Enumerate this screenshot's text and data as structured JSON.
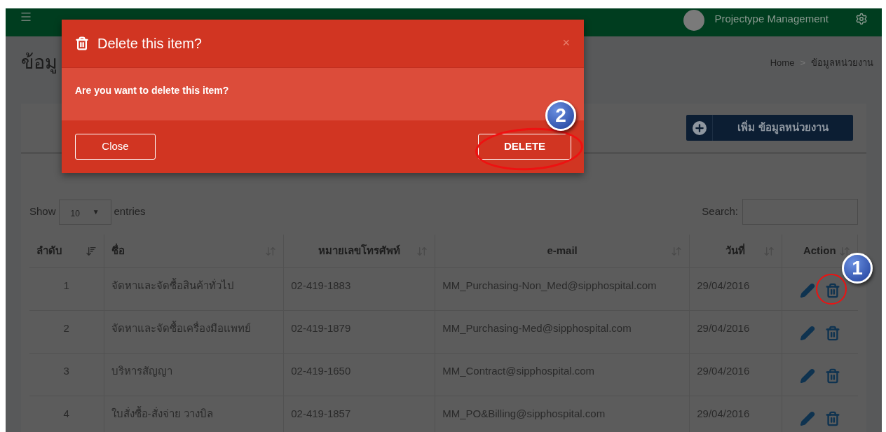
{
  "topbar": {
    "user_name": "Projectype Management"
  },
  "page_title": "ข้อมู",
  "breadcrumb": [
    "Home",
    ">",
    "ข้อมูลหน่วยงาน"
  ],
  "add_button": {
    "label": "เพิ่ม ข้อมูลหน่วยงาน"
  },
  "show_entries": {
    "label_before": "Show",
    "value": "10",
    "caret": "▼",
    "label_after": "entries"
  },
  "search": {
    "label": "Search:"
  },
  "table": {
    "columns": [
      {
        "label": "ลำดับ",
        "sorted": true
      },
      {
        "label": "ชื่อ",
        "sorted": false
      },
      {
        "label": "หมายเลขโทรศัพท์",
        "sorted": false
      },
      {
        "label": "e-mail",
        "sorted": false
      },
      {
        "label": "วันที่",
        "sorted": false
      },
      {
        "label": "Action",
        "sorted": false
      }
    ],
    "rows": [
      {
        "cells": [
          "1",
          "จัดหาและจัดซื้อสินค้าทั่วไป",
          "02-419-1883",
          "MM_Purchasing-Non_Med@sipphospital.com",
          "29/04/2016"
        ]
      },
      {
        "cells": [
          "2",
          "จัดหาและจัดซื้อเครื่องมือแพทย์",
          "02-419-1879",
          "MM_Purchasing-Med@sipphospital.com",
          "29/04/2016"
        ]
      },
      {
        "cells": [
          "3",
          "บริหารสัญญา",
          "02-419-1650",
          "MM_Contract@sipphospital.com",
          "29/04/2016"
        ]
      },
      {
        "cells": [
          "4",
          "ใบสั่งซื้อ-สั่งจ่าย วางบิล",
          "02-419-1857",
          "MM_PO&Billing@sipphospital.com",
          "29/04/2016"
        ]
      }
    ]
  },
  "modal": {
    "title": "Delete this item?",
    "close_symbol": "×",
    "message": "Are you want to delete this item?",
    "buttons": [
      {
        "label": "Close",
        "kind": "close"
      },
      {
        "label": "DELETE",
        "kind": "delete"
      }
    ]
  },
  "annotations": [
    {
      "label": "1"
    },
    {
      "label": "2"
    }
  ]
}
